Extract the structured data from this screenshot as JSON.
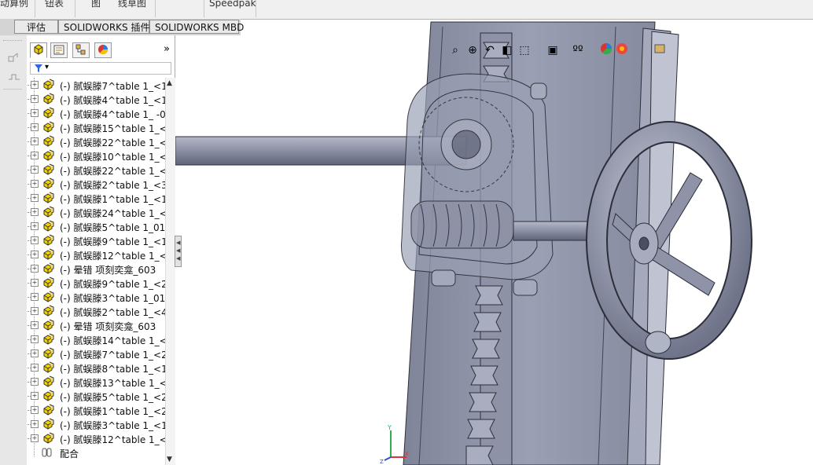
{
  "ribbon": {
    "items": [
      "动算例",
      "钮表",
      "图",
      "线草图",
      "Speedpak"
    ]
  },
  "command_tabs": [
    "评估",
    "SOLIDWORKS 插件",
    "SOLIDWORKS MBD"
  ],
  "feature_manager": {
    "overflow_chevron": "»",
    "filter_arrow": "▾",
    "tree_items": [
      "(-) 腻蜈滕7^table 1_<1",
      "(-) 腻蜈滕4^table 1_<1",
      "(-) 腻蜈滕4^table 1_ -0",
      "(-) 腻蜈滕15^table 1_<",
      "(-) 腻蜈滕22^table 1_<",
      "(-) 腻蜈滕10^table 1_<",
      "(-) 腻蜈滕22^table 1_<",
      "(-) 腻蜈滕2^table 1_<3",
      "(-) 腻蜈滕1^table 1_<1",
      "(-) 腻蜈滕24^table 1_<",
      "(-) 腻蜈滕5^table 1_01",
      "(-) 腻蜈滕9^table 1_<1",
      "(-) 腻蜈滕12^table 1_<",
      "(-) 晕错   项刻奕龛_603",
      "(-) 腻蜈滕9^table 1_<2",
      "(-) 腻蜈滕3^table 1_01",
      "(-) 腻蜈滕2^table 1_<4",
      "(-) 晕错   项刻奕龛_603",
      "(-) 腻蜈滕14^table 1_<",
      "(-) 腻蜈滕7^table 1_<2",
      "(-) 腻蜈滕8^table 1_<1",
      "(-) 腻蜈滕13^table 1_<",
      "(-) 腻蜈滕5^table 1_<2",
      "(-) 腻蜈滕1^table 1_<2",
      "(-) 腻蜈滕3^table 1_<1",
      "(-) 腻蜈滕12^table 1_<"
    ],
    "mates_label": "配合"
  },
  "colors": {
    "part_body": "#8e93a8",
    "part_edge": "#2c2f3a",
    "handwheel": "#9aa0b4",
    "accent": "#ffd400"
  },
  "icons": [
    "zoom-fit-icon",
    "zoom-area-icon",
    "previous-view-icon",
    "section-view-icon",
    "view-orientation-icon",
    "display-style-icon",
    "hide-show-icon",
    "appearance-icon",
    "scene-icon",
    "display-manager-icon"
  ]
}
